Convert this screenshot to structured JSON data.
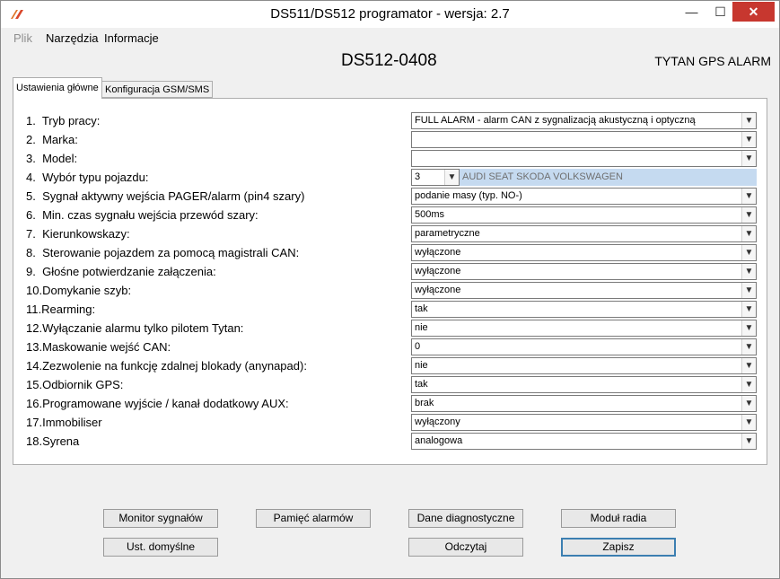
{
  "window": {
    "title": "DS511/DS512 programator - wersja:  2.7",
    "minimize_glyph": "—",
    "maximize_glyph": "☐",
    "close_glyph": "✕",
    "close_color": "#c7372f"
  },
  "menu": {
    "items": [
      "Plik",
      "Narzędzia",
      "Informacje"
    ]
  },
  "header": {
    "device": "DS512-0408",
    "brand": "TYTAN GPS ALARM"
  },
  "tabs": [
    "Ustawienia główne",
    "Konfiguracja GSM/SMS"
  ],
  "settings": [
    {
      "num": "1.",
      "label": "Tryb pracy:",
      "value": "FULL ALARM - alarm CAN z sygnalizacją akustyczną i optyczną"
    },
    {
      "num": "2.",
      "label": "Marka:",
      "value": ""
    },
    {
      "num": "3.",
      "label": "Model:",
      "value": ""
    },
    {
      "num": "4.",
      "label": "Wybór typu pojazdu:",
      "value": "3",
      "description": "AUDI SEAT SKODA VOLKSWAGEN"
    },
    {
      "num": "5.",
      "label": "Sygnał aktywny wejścia PAGER/alarm  (pin4 szary)",
      "value": "podanie masy (typ. NO-)"
    },
    {
      "num": "6.",
      "label": "Min. czas sygnału wejścia przewód szary:",
      "value": "500ms"
    },
    {
      "num": "7.",
      "label": "Kierunkowskazy:",
      "value": "parametryczne"
    },
    {
      "num": "8.",
      "label": "Sterowanie pojazdem za pomocą magistrali CAN:",
      "value": "wyłączone"
    },
    {
      "num": "9.",
      "label": "Głośne potwierdzanie załączenia:",
      "value": "wyłączone"
    },
    {
      "num": "10.",
      "label": "Domykanie szyb:",
      "value": "wyłączone"
    },
    {
      "num": "11.",
      "label": "Rearming:",
      "value": "tak"
    },
    {
      "num": "12.",
      "label": "Wyłączanie alarmu tylko pilotem Tytan:",
      "value": "nie"
    },
    {
      "num": "13.",
      "label": "Maskowanie wejść CAN:",
      "value": "0"
    },
    {
      "num": "14.",
      "label": "Zezwolenie na funkcję zdalnej blokady (anynapad):",
      "value": "nie"
    },
    {
      "num": "15.",
      "label": "Odbiornik GPS:",
      "value": "tak"
    },
    {
      "num": "16.",
      "label": "Programowane wyjście / kanał dodatkowy AUX:",
      "value": "brak"
    },
    {
      "num": "17.",
      "label": "Immobiliser",
      "value": "wyłączony"
    },
    {
      "num": "18.",
      "label": "Syrena",
      "value": "analogowa"
    }
  ],
  "buttons": {
    "monitor": "Monitor sygnałów",
    "alarm_memory": "Pamięć alarmów",
    "diagnostics": "Dane diagnostyczne",
    "radio_module": "Moduł radia",
    "defaults": "Ust. domyślne",
    "read": "Odczytaj",
    "save": "Zapisz"
  },
  "colors": {
    "vehicle_desc_bg": "#c5daf0",
    "default_button_border": "#3c7fb1"
  }
}
